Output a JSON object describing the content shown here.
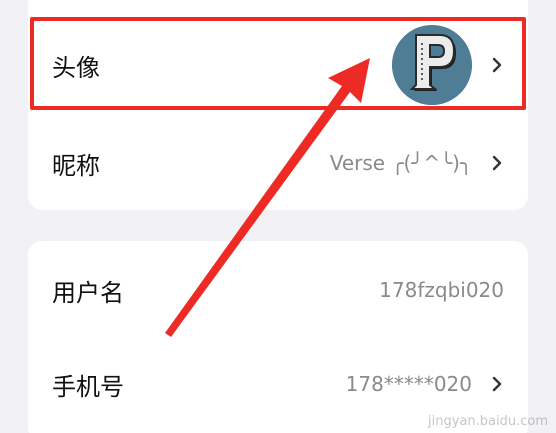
{
  "profile": {
    "avatar_label": "头像",
    "avatar_letter": "P",
    "nickname_label": "昵称",
    "nickname_value": "Verse ╭(╯^╰)╮"
  },
  "account": {
    "username_label": "用户名",
    "username_value": "178fzqbi020",
    "phone_label": "手机号",
    "phone_value": "178*****020"
  },
  "annotation": {
    "highlight_color": "#ee2a24",
    "arrow_color": "#ee2a24"
  },
  "watermark": {
    "text": "jingyan.baidu.com"
  },
  "colors": {
    "background": "#f2f2f6",
    "card": "#ffffff",
    "label_text": "#111111",
    "value_text": "#8a8a8a",
    "avatar_bg": "#4f7d96"
  }
}
